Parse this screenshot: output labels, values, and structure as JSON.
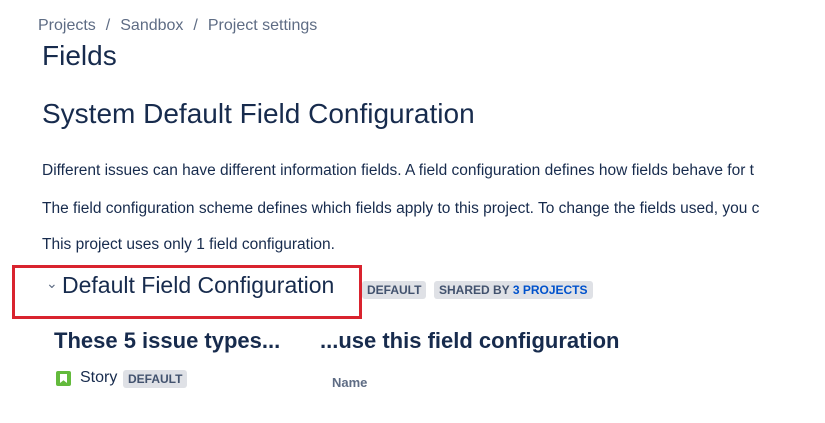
{
  "breadcrumb": {
    "items": [
      "Projects",
      "Sandbox",
      "Project settings"
    ],
    "separator": "/"
  },
  "page": {
    "title": "Fields",
    "section_title": "System Default Field Configuration",
    "paragraphs": [
      "Different issues can have different information fields. A field configuration defines how fields behave for t",
      "The field configuration scheme defines which fields apply to this project. To change the fields used, you c",
      "This project uses only 1 field configuration."
    ]
  },
  "config": {
    "chevron_icon": "chevron-down-icon",
    "title": "Default Field Configuration",
    "default_badge": "DEFAULT",
    "shared_prefix": "SHARED BY",
    "shared_count": "3 PROJECTS",
    "highlight_color": "#d9232e"
  },
  "issue_types": {
    "heading": "These 5 issue types...",
    "items": [
      {
        "name": "Story",
        "icon": "story-icon",
        "badge": "DEFAULT",
        "color": "#63ba3c"
      }
    ]
  },
  "field_config": {
    "heading": "...use this field configuration",
    "column_name": "Name"
  },
  "colors": {
    "text": "#172b4d",
    "subtle": "#5e6c84",
    "link": "#0052cc",
    "lozenge_bg": "#dfe1e6"
  }
}
